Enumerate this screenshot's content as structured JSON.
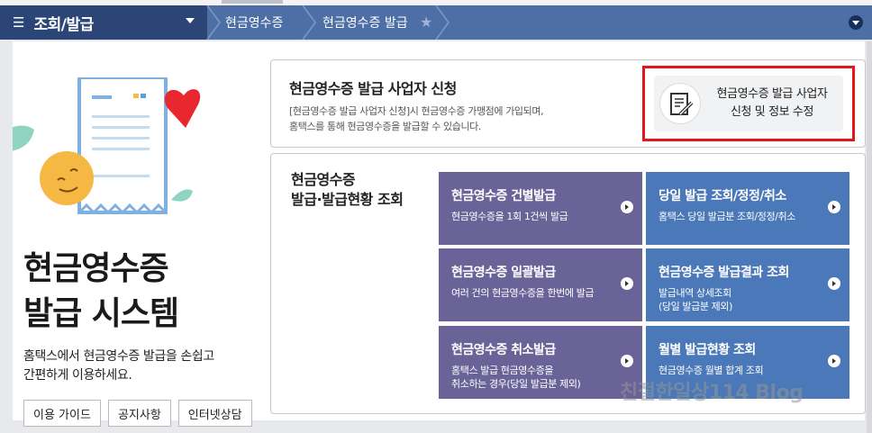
{
  "nav": {
    "menu_title": "조회/발급",
    "breadcrumbs": [
      "현금영수증",
      "현금영수증 발급"
    ]
  },
  "hero": {
    "title_line1": "현금영수증",
    "title_line2": "발급 시스템",
    "desc_line1": "홈택스에서 현금영수증 발급을 손쉽고",
    "desc_line2": "간편하게 이용하세요.",
    "buttons": [
      "이용 가이드",
      "공지사항",
      "인터넷상담"
    ]
  },
  "apply": {
    "title": "현금영수증 발급 사업자 신청",
    "desc_line1": "[현금영수증 발급 사업자 신청]시 현금영수증 가맹점에 가입되며,",
    "desc_line2": "홈택스를 통해 현금영수증을 발급할 수 있습니다.",
    "button_line1": "현금영수증 발급 사업자",
    "button_line2": "신청 및 정보 수정"
  },
  "issue": {
    "title_line1": "현금영수증",
    "title_line2": "발급·발급현황 조회",
    "tiles": [
      {
        "title": "현금영수증 건별발급",
        "sub": [
          "현금영수증을 1회 1건씩 발급"
        ]
      },
      {
        "title": "당일 발급 조회/정정/취소",
        "sub": [
          "홈택스 당일 발급분 조회/정정/취소"
        ]
      },
      {
        "title": "현금영수증 일괄발급",
        "sub": [
          "여러 건의 현금영수증을 한번에 발급"
        ]
      },
      {
        "title": "현금영수증 발급결과 조회",
        "sub": [
          "발급내역 상세조회",
          "(당일 발급분 제외)"
        ]
      },
      {
        "title": "현금영수증 취소발급",
        "sub": [
          "홈택스 발급 현금영수증을",
          "취소하는 경우(당일 발급분 제외)"
        ]
      },
      {
        "title": "월별 발급현황 조회",
        "sub": [
          "현금영수증 월별 합계 조회"
        ]
      }
    ]
  },
  "watermark": "친절한일상114 Blog",
  "colors": {
    "nav_bg": "#4d6fa6",
    "menu_bg": "#2b4576",
    "tile_purple": "#6a6398",
    "tile_blue": "#4a78b8",
    "highlight": "#e8141c"
  }
}
